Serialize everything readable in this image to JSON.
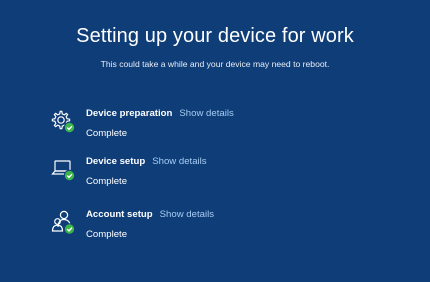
{
  "title": "Setting up your device for work",
  "subtitle": "This could take a while and your device may need to reboot.",
  "colors": {
    "background": "#0e3d78",
    "link": "#a8cdf5",
    "check": "#3bb34a"
  },
  "steps": [
    {
      "name": "Device preparation",
      "link": "Show details",
      "status": "Complete",
      "icon": "gear-icon"
    },
    {
      "name": "Device setup",
      "link": "Show details",
      "status": "Complete",
      "icon": "laptop-icon"
    },
    {
      "name": "Account setup",
      "link": "Show details",
      "status": "Complete",
      "icon": "people-icon"
    }
  ]
}
